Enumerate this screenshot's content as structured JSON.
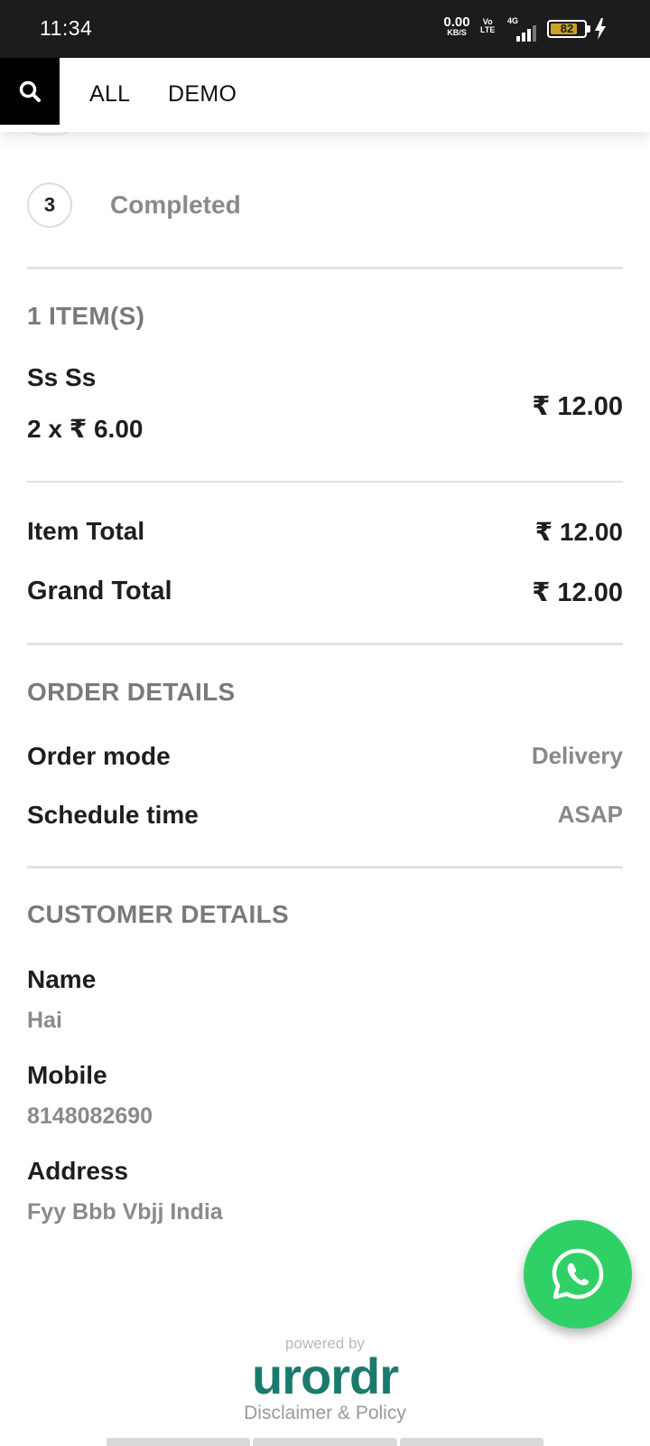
{
  "status_bar": {
    "time": "11:34",
    "net_speed_value": "0.00",
    "net_speed_unit": "KB/S",
    "volte_top": "Vo",
    "volte_bottom": "LTE",
    "network_type": "4G",
    "battery_percent": 82,
    "battery_label": "82",
    "charging": true
  },
  "nav": {
    "links": [
      "ALL",
      "DEMO"
    ]
  },
  "order_status": {
    "step_number": "3",
    "step_label": "Completed"
  },
  "items": {
    "heading": "1 ITEM(S)",
    "list": [
      {
        "name": "Ss Ss",
        "qty_price": "2 x ₹ 6.00",
        "total": "₹ 12.00"
      }
    ]
  },
  "totals": {
    "item_total_label": "Item Total",
    "item_total_value": "₹ 12.00",
    "grand_total_label": "Grand Total",
    "grand_total_value": "₹ 12.00"
  },
  "order_details": {
    "heading": "ORDER DETAILS",
    "mode_label": "Order mode",
    "mode_value": "Delivery",
    "schedule_label": "Schedule time",
    "schedule_value": "ASAP"
  },
  "customer_details": {
    "heading": "CUSTOMER DETAILS",
    "name_label": "Name",
    "name_value": "Hai",
    "mobile_label": "Mobile",
    "mobile_value": "8148082690",
    "address_label": "Address",
    "address_value": "Fyy Bbb Vbjj India"
  },
  "footer": {
    "powered_by": "powered by",
    "brand": "urordr",
    "disclaimer": "Disclaimer & Policy"
  },
  "colors": {
    "whatsapp_green": "#2fd166",
    "brand_teal": "#1b7a6e",
    "battery_fill": "#c9a227"
  },
  "icons": [
    "search-icon",
    "whatsapp-icon",
    "charging-icon",
    "signal-icon"
  ]
}
